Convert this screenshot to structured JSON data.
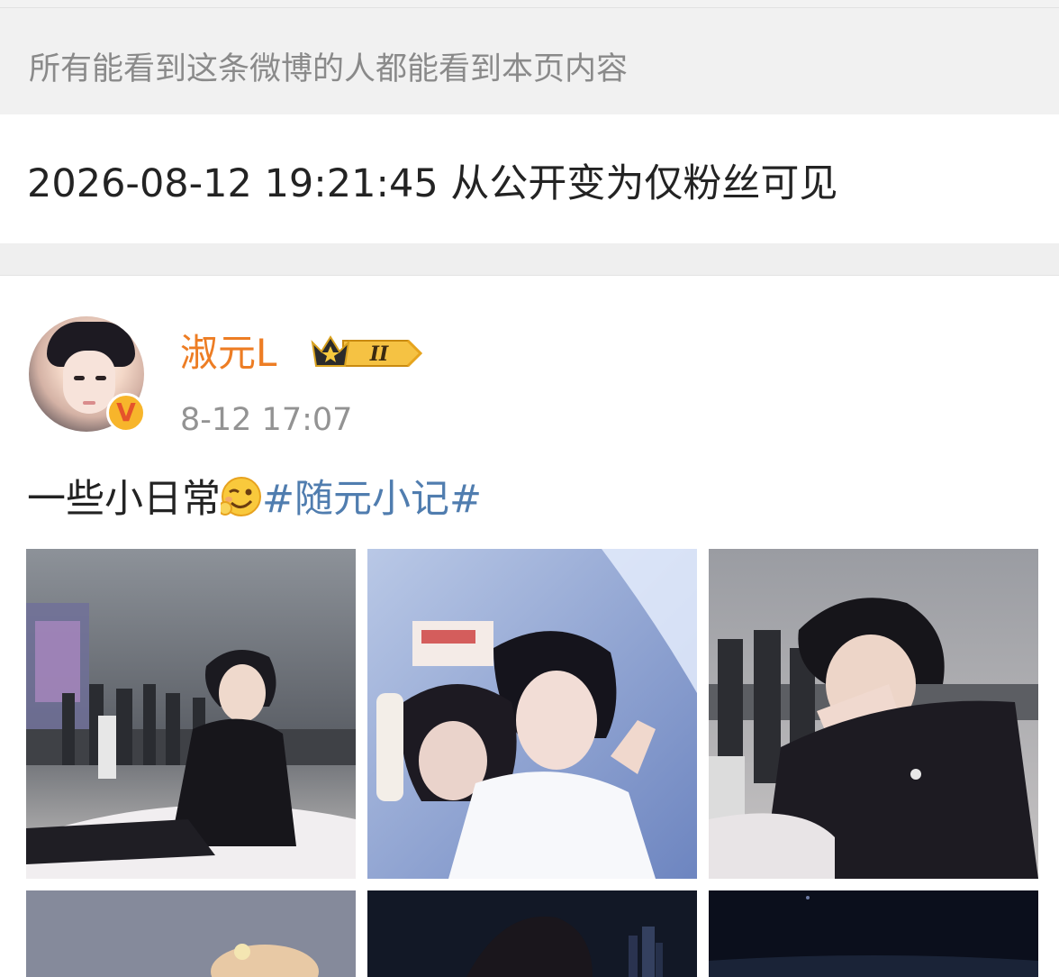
{
  "visibility_notice": "所有能看到这条微博的人都能看到本页内容",
  "visibility_change": "2026-08-12 19:21:45 从公开变为仅粉丝可见",
  "post": {
    "author": "淑元L",
    "vip_level": "II",
    "verified_mark": "V",
    "time": "8-12 17:07",
    "text": "一些小日常",
    "emoji": "wink-emoji",
    "topic": "#随元小记#",
    "photos": [
      {
        "name": "photo-1"
      },
      {
        "name": "photo-2"
      },
      {
        "name": "photo-3"
      },
      {
        "name": "photo-4"
      },
      {
        "name": "photo-5"
      },
      {
        "name": "photo-6"
      }
    ],
    "colors": {
      "author": "#ed7d24",
      "topic": "#507daf"
    }
  }
}
